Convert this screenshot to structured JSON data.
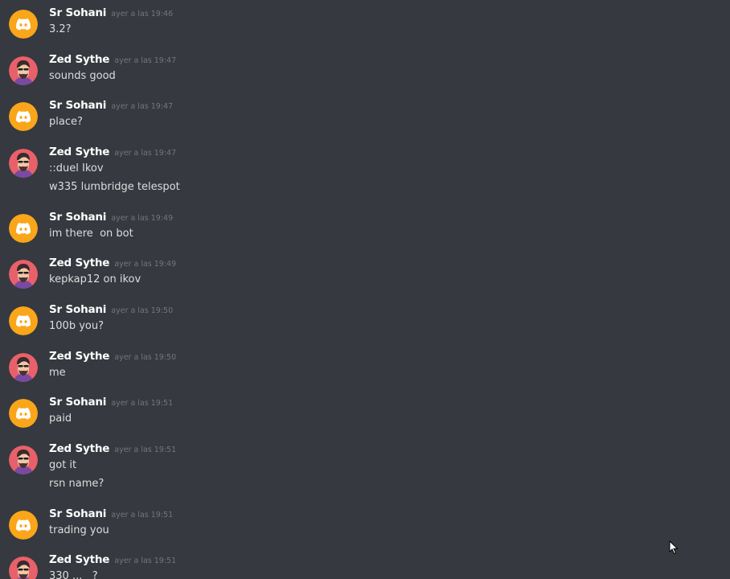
{
  "messages": [
    {
      "author": "Sr Sohani",
      "avatar": "discord-logo-icon",
      "timestamp": "ayer a las 19:46",
      "lines": [
        "3.2?"
      ]
    },
    {
      "author": "Zed Sythe",
      "avatar": "character-avatar",
      "timestamp": "ayer a las 19:47",
      "lines": [
        "sounds good"
      ]
    },
    {
      "author": "Sr Sohani",
      "avatar": "discord-logo-icon",
      "timestamp": "ayer a las 19:47",
      "lines": [
        "place?"
      ]
    },
    {
      "author": "Zed Sythe",
      "avatar": "character-avatar",
      "timestamp": "ayer a las 19:47",
      "lines": [
        "::duel Ikov",
        "w335 lumbridge telespot"
      ]
    },
    {
      "author": "Sr Sohani",
      "avatar": "discord-logo-icon",
      "timestamp": "ayer a las 19:49",
      "lines": [
        "im there  on bot"
      ]
    },
    {
      "author": "Zed Sythe",
      "avatar": "character-avatar",
      "timestamp": "ayer a las 19:49",
      "lines": [
        "kepkap12 on ikov"
      ]
    },
    {
      "author": "Sr Sohani",
      "avatar": "discord-logo-icon",
      "timestamp": "ayer a las 19:50",
      "lines": [
        "100b you?"
      ]
    },
    {
      "author": "Zed Sythe",
      "avatar": "character-avatar",
      "timestamp": "ayer a las 19:50",
      "lines": [
        "me"
      ]
    },
    {
      "author": "Sr Sohani",
      "avatar": "discord-logo-icon",
      "timestamp": "ayer a las 19:51",
      "lines": [
        "paid"
      ]
    },
    {
      "author": "Zed Sythe",
      "avatar": "character-avatar",
      "timestamp": "ayer a las 19:51",
      "lines": [
        "got it",
        "rsn name?"
      ]
    },
    {
      "author": "Sr Sohani",
      "avatar": "discord-logo-icon",
      "timestamp": "ayer a las 19:51",
      "lines": [
        "trading you"
      ]
    },
    {
      "author": "Zed Sythe",
      "avatar": "character-avatar",
      "timestamp": "ayer a las 19:51",
      "lines": [
        "330 ...   ?"
      ]
    }
  ],
  "colors": {
    "background": "#36393f",
    "username": "#ffffff",
    "message_text": "#dcddde",
    "timestamp": "#72767d",
    "discord_avatar_bg": "#faa61a"
  }
}
